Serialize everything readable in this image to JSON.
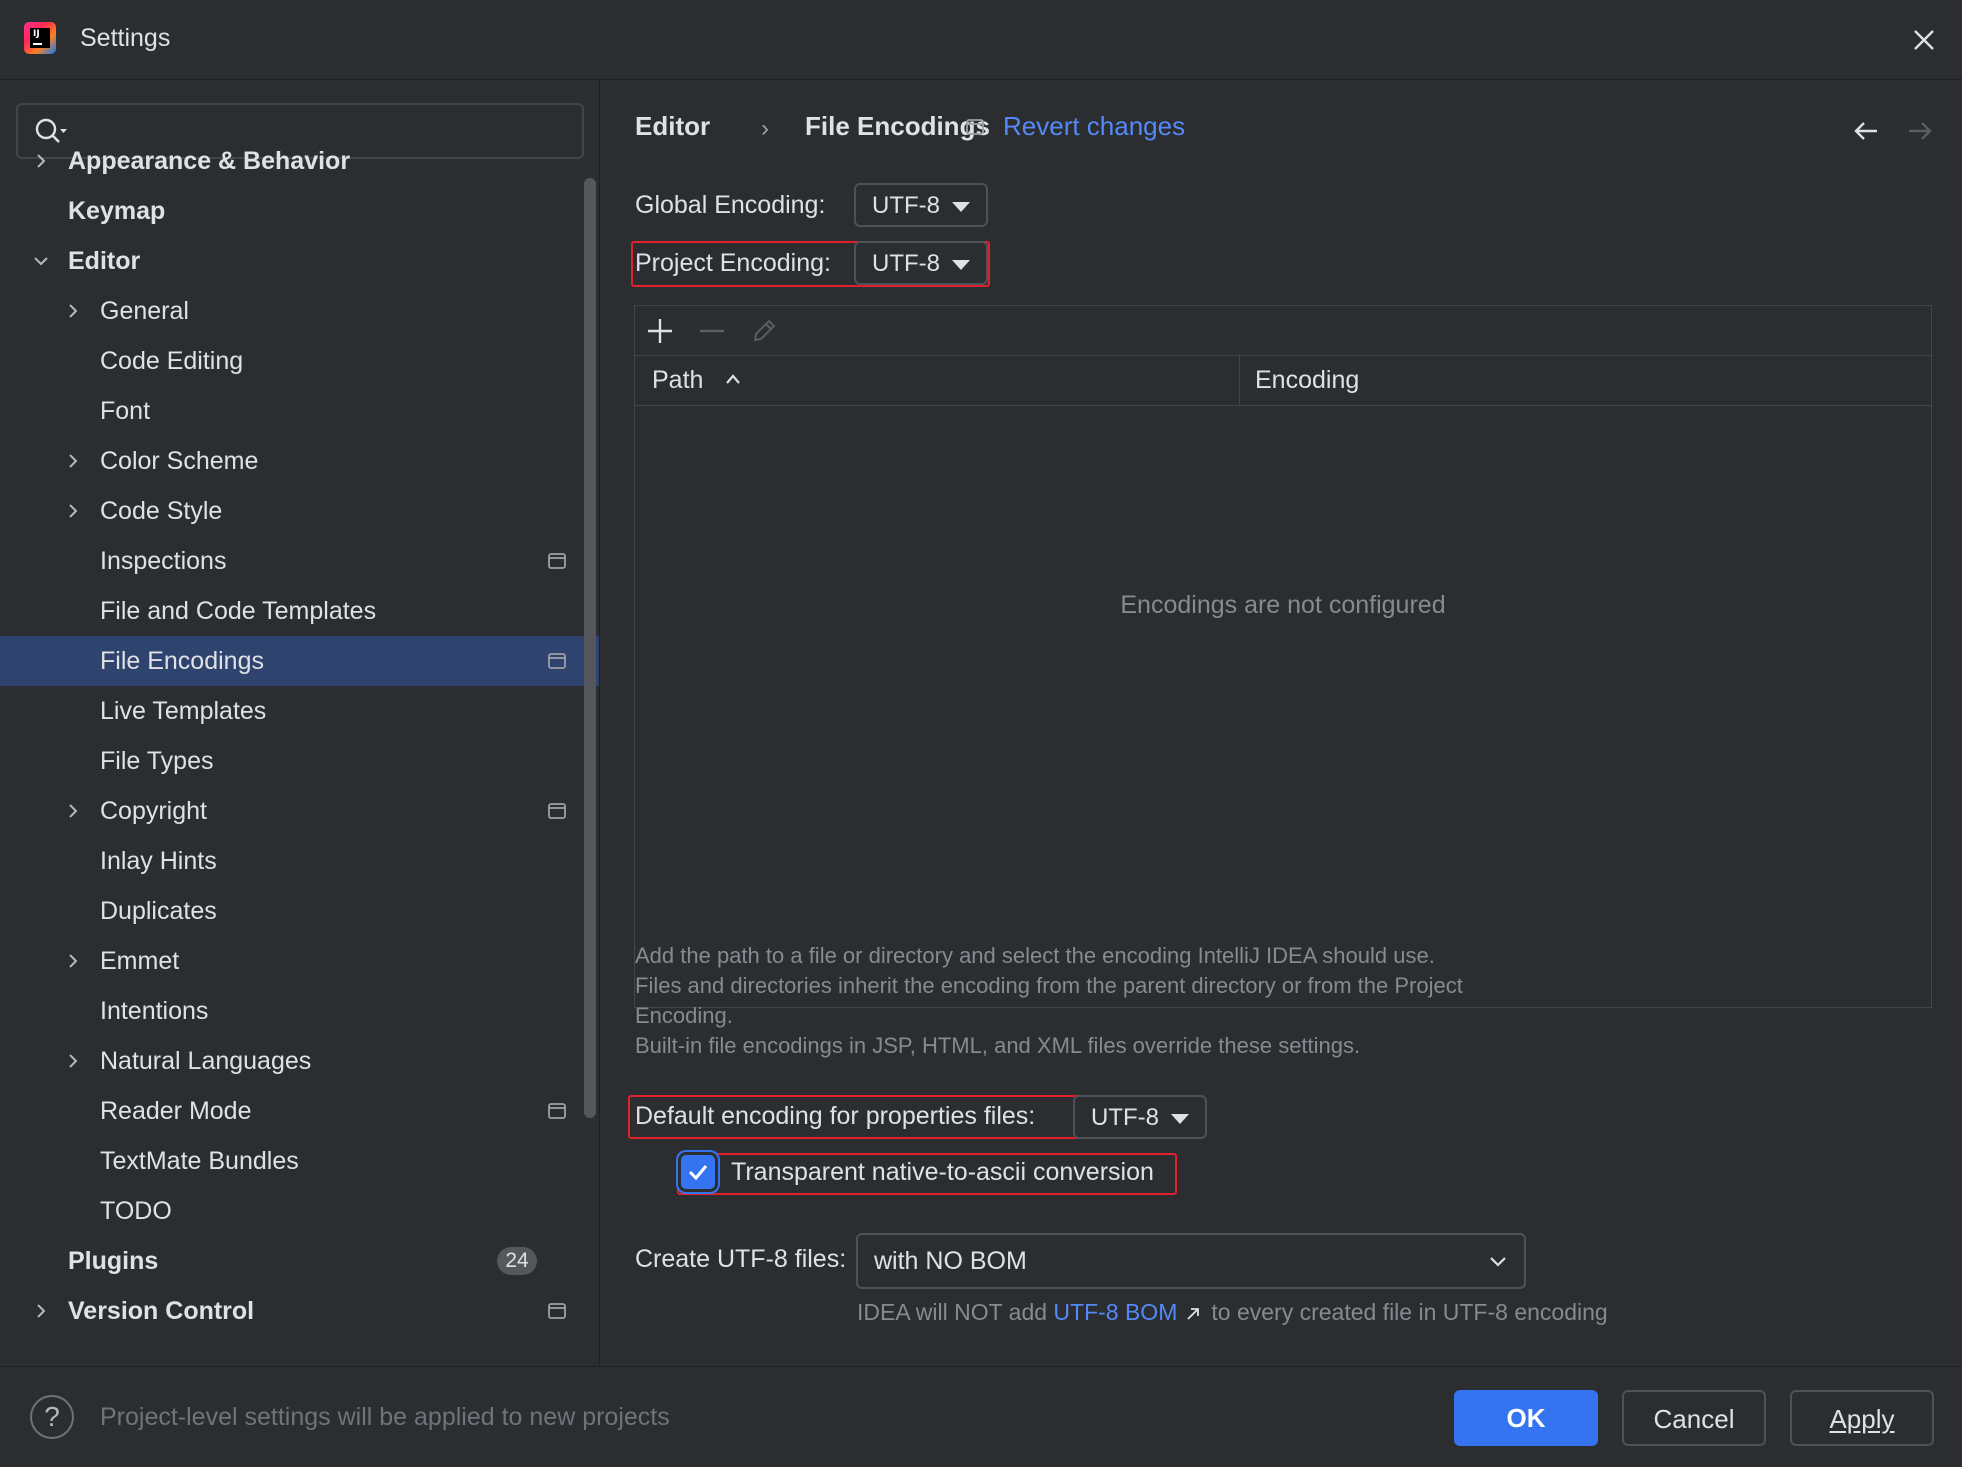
{
  "window": {
    "title": "Settings"
  },
  "search": {
    "placeholder": ""
  },
  "sidebar": {
    "items": [
      {
        "label": "Appearance & Behavior",
        "level": 0,
        "expandable": true,
        "expanded": false,
        "bold": true
      },
      {
        "label": "Keymap",
        "level": 0,
        "expandable": false,
        "bold": true
      },
      {
        "label": "Editor",
        "level": 0,
        "expandable": true,
        "expanded": true,
        "bold": true
      },
      {
        "label": "General",
        "level": 1,
        "expandable": true
      },
      {
        "label": "Code Editing",
        "level": 1
      },
      {
        "label": "Font",
        "level": 1
      },
      {
        "label": "Color Scheme",
        "level": 1,
        "expandable": true
      },
      {
        "label": "Code Style",
        "level": 1,
        "expandable": true
      },
      {
        "label": "Inspections",
        "level": 1,
        "project_level": true
      },
      {
        "label": "File and Code Templates",
        "level": 1
      },
      {
        "label": "File Encodings",
        "level": 1,
        "project_level": true,
        "selected": true
      },
      {
        "label": "Live Templates",
        "level": 1
      },
      {
        "label": "File Types",
        "level": 1
      },
      {
        "label": "Copyright",
        "level": 1,
        "expandable": true,
        "project_level": true
      },
      {
        "label": "Inlay Hints",
        "level": 1
      },
      {
        "label": "Duplicates",
        "level": 1
      },
      {
        "label": "Emmet",
        "level": 1,
        "expandable": true
      },
      {
        "label": "Intentions",
        "level": 1
      },
      {
        "label": "Natural Languages",
        "level": 1,
        "expandable": true
      },
      {
        "label": "Reader Mode",
        "level": 1,
        "project_level": true
      },
      {
        "label": "TextMate Bundles",
        "level": 1
      },
      {
        "label": "TODO",
        "level": 1
      },
      {
        "label": "Plugins",
        "level": 0,
        "bold": true,
        "badge": "24"
      },
      {
        "label": "Version Control",
        "level": 0,
        "expandable": true,
        "bold": true,
        "project_level": true
      }
    ]
  },
  "breadcrumb": {
    "parent": "Editor",
    "separator": "›",
    "current": "File Encodings"
  },
  "revert": {
    "label": "Revert changes"
  },
  "global_encoding": {
    "label": "Global Encoding:",
    "value": "UTF-8"
  },
  "project_encoding": {
    "label": "Project Encoding:",
    "value": "UTF-8"
  },
  "table": {
    "columns": [
      "Path",
      "Encoding"
    ],
    "empty_text": "Encodings are not configured",
    "toolbar": [
      "add-icon",
      "remove-icon",
      "edit-icon"
    ]
  },
  "hint": {
    "line1": "Add the path to a file or directory and select the encoding IntelliJ IDEA should use.",
    "line2": "Files and directories inherit the encoding from the parent directory or from the Project",
    "line3": "Encoding.",
    "line4": "Built-in file encodings in JSP, HTML, and XML files override these settings."
  },
  "properties_encoding": {
    "label": "Default encoding for properties files:",
    "value": "UTF-8"
  },
  "native_to_ascii": {
    "label": "Transparent native-to-ascii conversion",
    "checked": true
  },
  "create_utf8": {
    "label": "Create UTF-8 files:",
    "value": "with NO BOM"
  },
  "bom_hint": {
    "prefix": "IDEA will NOT add",
    "link": "UTF-8 BOM",
    "suffix": "to every created file in UTF-8 encoding"
  },
  "footer": {
    "help": "?",
    "note": "Project-level settings will be applied to new projects",
    "ok": "OK",
    "cancel": "Cancel",
    "apply": "Apply"
  },
  "colors": {
    "background": "#2b2d30",
    "selection": "#2e436e",
    "accent": "#3574f0",
    "link": "#548af7",
    "highlight_outline": "#e0202a"
  }
}
